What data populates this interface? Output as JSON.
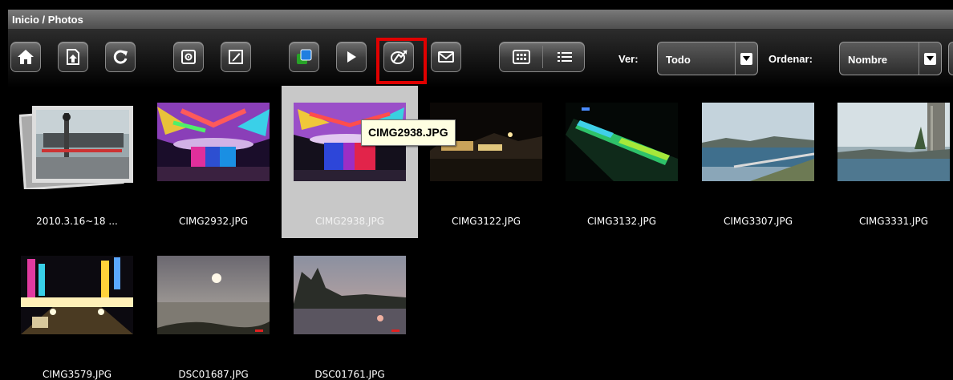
{
  "breadcrumb": "Inicio / Photos",
  "toolbar": {
    "buttons": [
      {
        "name": "home-button",
        "icon": "home-icon"
      },
      {
        "name": "upload-button",
        "icon": "upload-icon"
      },
      {
        "name": "refresh-button",
        "icon": "refresh-icon"
      },
      {
        "name": "settings-button",
        "icon": "settings-icon"
      },
      {
        "name": "edit-button",
        "icon": "edit-icon"
      },
      {
        "name": "copy-button",
        "icon": "copy-icon"
      },
      {
        "name": "play-slideshow-button",
        "icon": "play-icon"
      },
      {
        "name": "publish-button",
        "icon": "publish-icon"
      },
      {
        "name": "email-button",
        "icon": "mail-icon"
      },
      {
        "name": "grid-view-button",
        "icon": "grid-icon"
      },
      {
        "name": "list-view-button",
        "icon": "list-icon"
      }
    ],
    "view_label": "Ver:",
    "view_value": "Todo",
    "sort_label": "Ordenar:",
    "sort_value": "Nombre",
    "colors": {
      "highlight": "#e00000",
      "selected_tile": "#c8c8c8"
    }
  },
  "tooltip": "CIMG2938.JPG",
  "items": [
    {
      "caption": "2010.3.16~18 ...",
      "kind": "folder"
    },
    {
      "caption": "CIMG2932.JPG"
    },
    {
      "caption": "CIMG2938.JPG",
      "selected": true
    },
    {
      "caption": "CIMG3122.JPG"
    },
    {
      "caption": "CIMG3132.JPG"
    },
    {
      "caption": "CIMG3307.JPG"
    },
    {
      "caption": "CIMG3331.JPG"
    },
    {
      "caption": "CIMG3579.JPG"
    },
    {
      "caption": "DSC01687.JPG"
    },
    {
      "caption": "DSC01761.JPG"
    }
  ]
}
